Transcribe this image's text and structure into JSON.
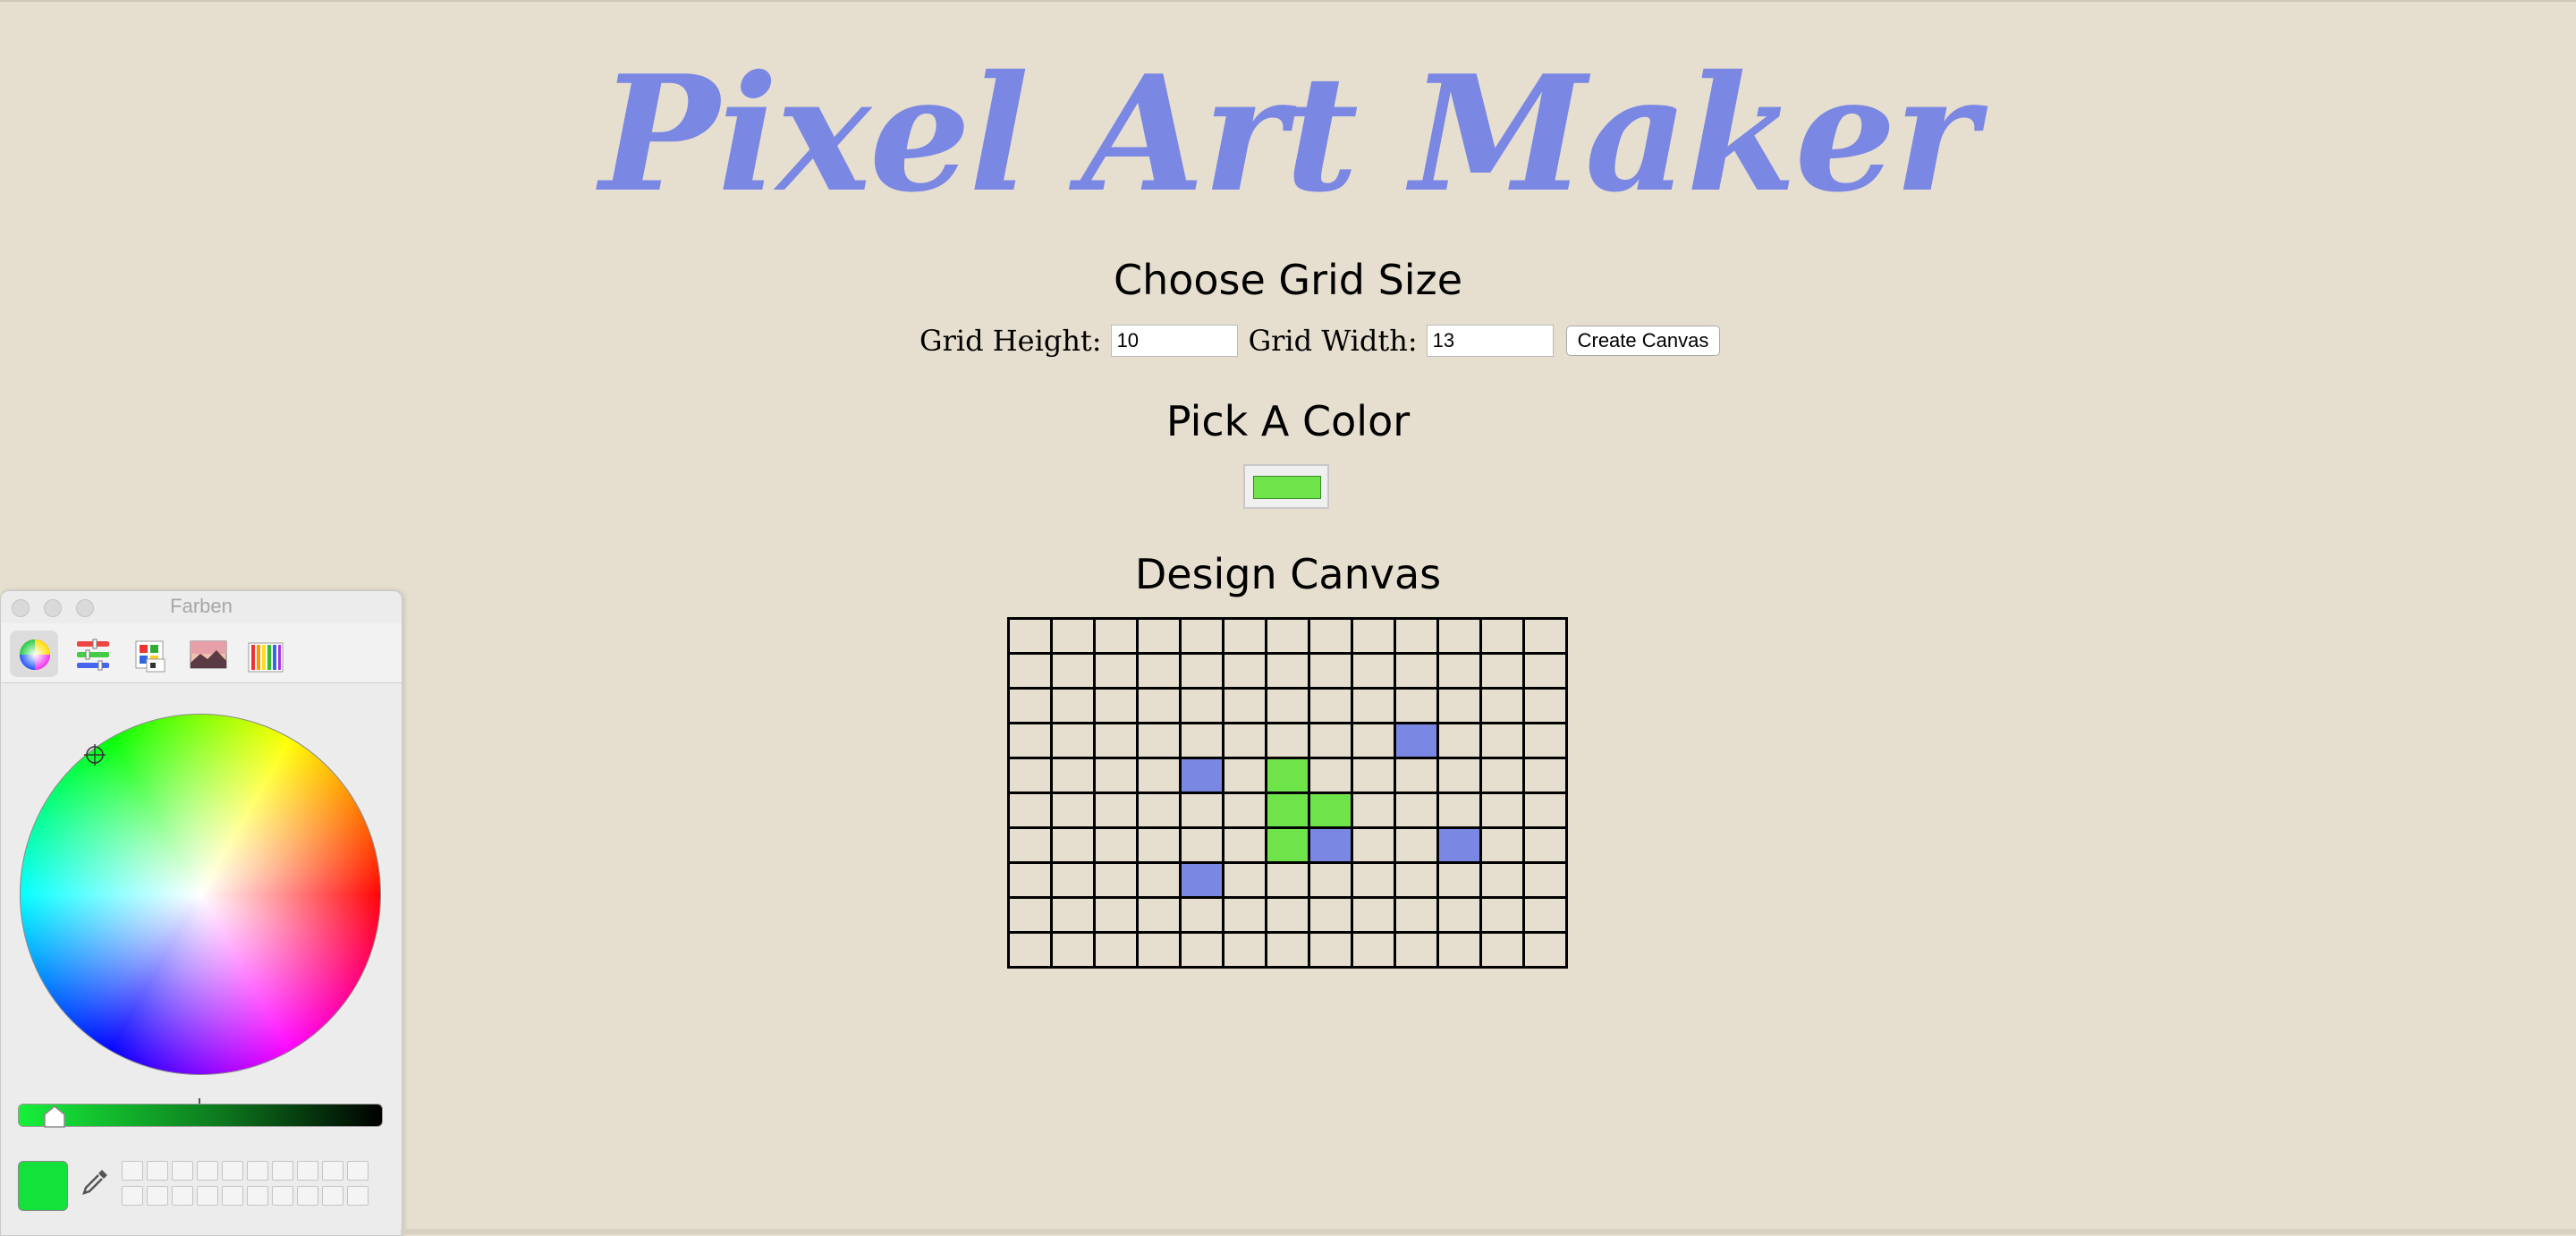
{
  "app": {
    "title": "Pixel Art Maker"
  },
  "grid_size": {
    "heading": "Choose Grid Size",
    "height_label": "Grid Height:",
    "height_value": "10",
    "width_label": "Grid Width:",
    "width_value": "13",
    "submit_label": "Create Canvas"
  },
  "color_picker": {
    "heading": "Pick A Color",
    "value": "#6fe34a"
  },
  "canvas": {
    "heading": "Design Canvas",
    "rows": 10,
    "cols": 13,
    "cell_color": "#e6dfcf",
    "painted": [
      {
        "row": 3,
        "col": 9,
        "color": "#7a87e3"
      },
      {
        "row": 4,
        "col": 4,
        "color": "#7a87e3"
      },
      {
        "row": 4,
        "col": 6,
        "color": "#6fe34a"
      },
      {
        "row": 5,
        "col": 6,
        "color": "#6fe34a"
      },
      {
        "row": 5,
        "col": 7,
        "color": "#6fe34a"
      },
      {
        "row": 6,
        "col": 6,
        "color": "#6fe34a"
      },
      {
        "row": 6,
        "col": 7,
        "color": "#7a87e3"
      },
      {
        "row": 6,
        "col": 10,
        "color": "#7a87e3"
      },
      {
        "row": 7,
        "col": 4,
        "color": "#7a87e3"
      }
    ]
  },
  "color_panel": {
    "title": "Farben",
    "tools": [
      "color-wheel",
      "color-sliders",
      "color-palettes",
      "image-palettes",
      "pencils"
    ],
    "active_tool": "color-wheel",
    "current_color": "#13e23a",
    "brightness": 0.1
  },
  "colors": {
    "background": "#e6dfcf",
    "title": "#7a87e3",
    "accent_green": "#6fe34a",
    "accent_blue": "#7a87e3"
  }
}
